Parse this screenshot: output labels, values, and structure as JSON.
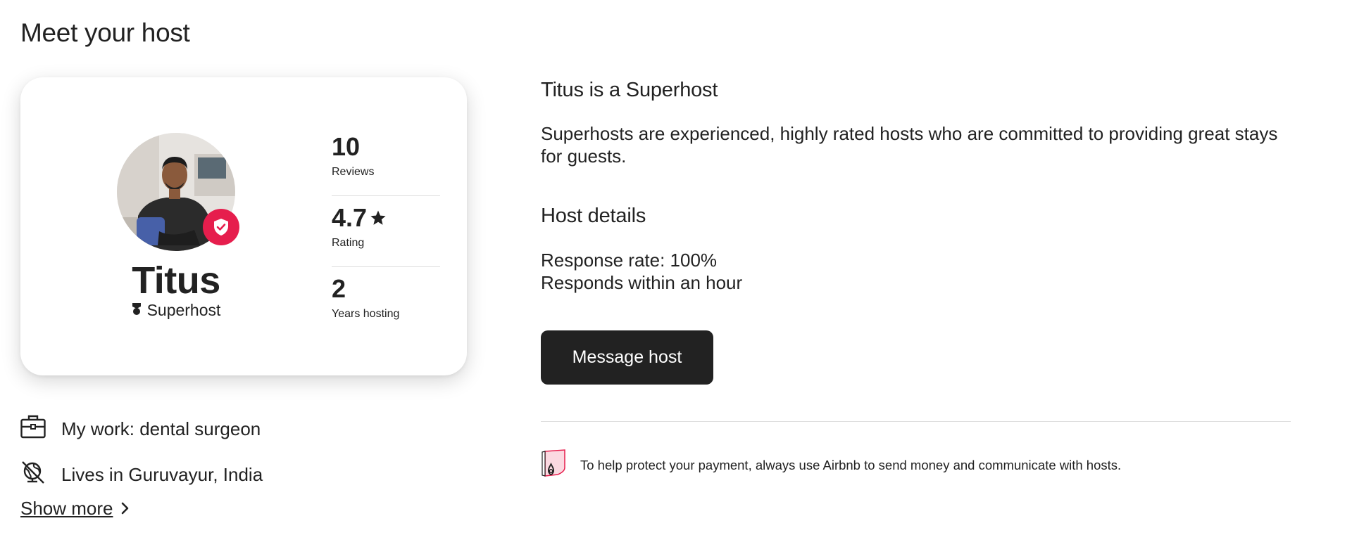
{
  "section": {
    "title": "Meet your host"
  },
  "host": {
    "name": "Titus",
    "superhost_label": "Superhost",
    "stats": [
      {
        "value": "10",
        "label": "Reviews"
      },
      {
        "value": "4.7",
        "label": "Rating"
      },
      {
        "value": "2",
        "label": "Years hosting"
      }
    ]
  },
  "about": {
    "work": "My work: dental surgeon",
    "lives": "Lives in Guruvayur, India",
    "show_more": "Show more"
  },
  "superhost_info": {
    "heading": "Titus is a Superhost",
    "description": "Superhosts are experienced, highly rated hosts who are committed to providing great stays for guests."
  },
  "host_details": {
    "heading": "Host details",
    "response_rate": "Response rate: 100%",
    "response_time": "Responds within an hour"
  },
  "actions": {
    "message_host": "Message host"
  },
  "notice": {
    "text": "To help protect your payment, always use Airbnb to send money and communicate with hosts."
  },
  "icons": {
    "briefcase": "briefcase-icon",
    "globe": "globe-icon",
    "chevron": "chevron-right-icon",
    "star": "star-icon",
    "shield_badge": "superhost-badge-icon",
    "superhost": "superhost-medal-icon",
    "payment_shield": "payment-shield-icon"
  },
  "colors": {
    "brand": "#e61e4d",
    "text": "#222222",
    "button": "#222222",
    "divider": "#dddddd"
  }
}
